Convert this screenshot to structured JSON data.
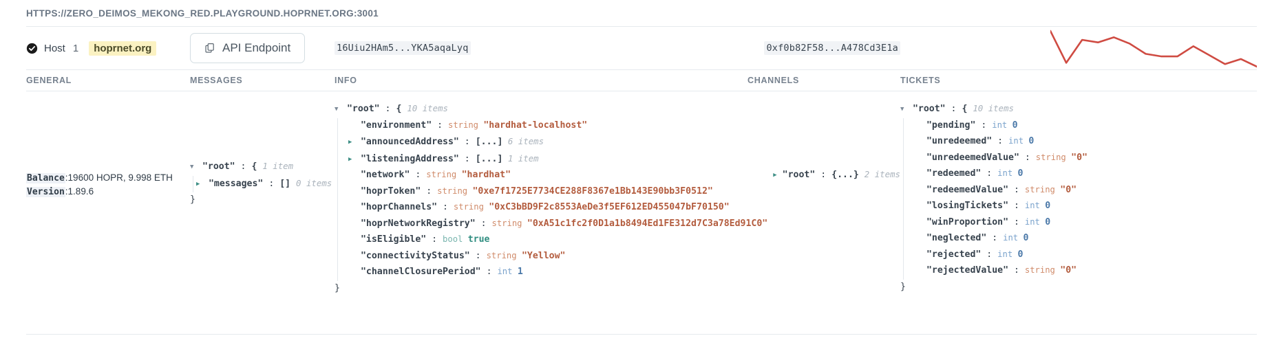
{
  "url_bar": {
    "text": "HTTPS://ZERO_DEIMOS_MEKONG_RED.PLAYGROUND.HOPRNET.ORG:3001"
  },
  "host_row": {
    "status_icon": "check-circle-icon",
    "host_label": "Host",
    "host_number": "1",
    "host_badge": "hoprnet.org",
    "api_button": {
      "icon": "copy-icon",
      "label": "API Endpoint"
    },
    "peer_id": "16Uiu2HAm5...YKA5aqaLyq",
    "eth_address": "0xf0b82F58...A478Cd3E1a"
  },
  "columns": {
    "general": "GENERAL",
    "messages": "MESSAGES",
    "info": "INFO",
    "channels": "CHANNELS",
    "tickets": "TICKETS"
  },
  "general": {
    "balance_label": "Balance",
    "balance_value": ":19600 HOPR, 9.998 ETH",
    "version_label": "Version",
    "version_value": ":1.89.6"
  },
  "messages_tree": {
    "root_key": "\"root\"",
    "root_open": "{",
    "root_count": "1 item",
    "root_close": "}",
    "child_key": "\"messages\"",
    "child_value": "[]",
    "child_count": "0 items"
  },
  "info_tree": {
    "root_key": "\"root\"",
    "root_open": "{",
    "root_count": "10 items",
    "root_close": "}",
    "rows": [
      {
        "key": "\"environment\"",
        "type": "string",
        "value": "\"hardhat-localhost\"",
        "kind": "string",
        "expandable": false
      },
      {
        "key": "\"announcedAddress\"",
        "type": "",
        "value": "[...]",
        "count": "6 items",
        "kind": "array",
        "expandable": true
      },
      {
        "key": "\"listeningAddress\"",
        "type": "",
        "value": "[...]",
        "count": "1 item",
        "kind": "array",
        "expandable": true
      },
      {
        "key": "\"network\"",
        "type": "string",
        "value": "\"hardhat\"",
        "kind": "string",
        "expandable": false
      },
      {
        "key": "\"hoprToken\"",
        "type": "string",
        "value": "\"0xe7f1725E7734CE288F8367e1Bb143E90bb3F0512\"",
        "kind": "string",
        "expandable": false
      },
      {
        "key": "\"hoprChannels\"",
        "type": "string",
        "value": "\"0xC3bBD9F2c8553AeDe3f5EF612ED455047bF70150\"",
        "kind": "string",
        "expandable": false
      },
      {
        "key": "\"hoprNetworkRegistry\"",
        "type": "string",
        "value": "\"0xA51c1fc2f0D1a1b8494Ed1FE312d7C3a78Ed91C0\"",
        "kind": "string",
        "expandable": false
      },
      {
        "key": "\"isEligible\"",
        "type": "bool",
        "value": "true",
        "kind": "bool",
        "expandable": false
      },
      {
        "key": "\"connectivityStatus\"",
        "type": "string",
        "value": "\"Yellow\"",
        "kind": "string",
        "expandable": false
      },
      {
        "key": "\"channelClosurePeriod\"",
        "type": "int",
        "value": "1",
        "kind": "int",
        "expandable": false
      }
    ]
  },
  "channels_tree": {
    "root_key": "\"root\"",
    "root_value": "{...}",
    "root_count": "2 items"
  },
  "tickets_tree": {
    "root_key": "\"root\"",
    "root_open": "{",
    "root_count": "10 items",
    "root_close": "}",
    "rows": [
      {
        "key": "\"pending\"",
        "type": "int",
        "value": "0",
        "kind": "int"
      },
      {
        "key": "\"unredeemed\"",
        "type": "int",
        "value": "0",
        "kind": "int"
      },
      {
        "key": "\"unredeemedValue\"",
        "type": "string",
        "value": "\"0\"",
        "kind": "string"
      },
      {
        "key": "\"redeemed\"",
        "type": "int",
        "value": "0",
        "kind": "int"
      },
      {
        "key": "\"redeemedValue\"",
        "type": "string",
        "value": "\"0\"",
        "kind": "string"
      },
      {
        "key": "\"losingTickets\"",
        "type": "int",
        "value": "0",
        "kind": "int"
      },
      {
        "key": "\"winProportion\"",
        "type": "int",
        "value": "0",
        "kind": "int"
      },
      {
        "key": "\"neglected\"",
        "type": "int",
        "value": "0",
        "kind": "int"
      },
      {
        "key": "\"rejected\"",
        "type": "int",
        "value": "0",
        "kind": "int"
      },
      {
        "key": "\"rejectedValue\"",
        "type": "string",
        "value": "\"0\"",
        "kind": "string"
      }
    ]
  },
  "sparkline": {
    "color": "#cf4b42",
    "points": [
      58,
      8,
      44,
      40,
      48,
      38,
      22,
      18,
      18,
      34,
      20,
      6,
      14,
      2
    ]
  },
  "colors": {
    "accent_red": "#cf4b42",
    "badge_yellow": "#fbf2c2",
    "header_gray": "#77828f"
  }
}
